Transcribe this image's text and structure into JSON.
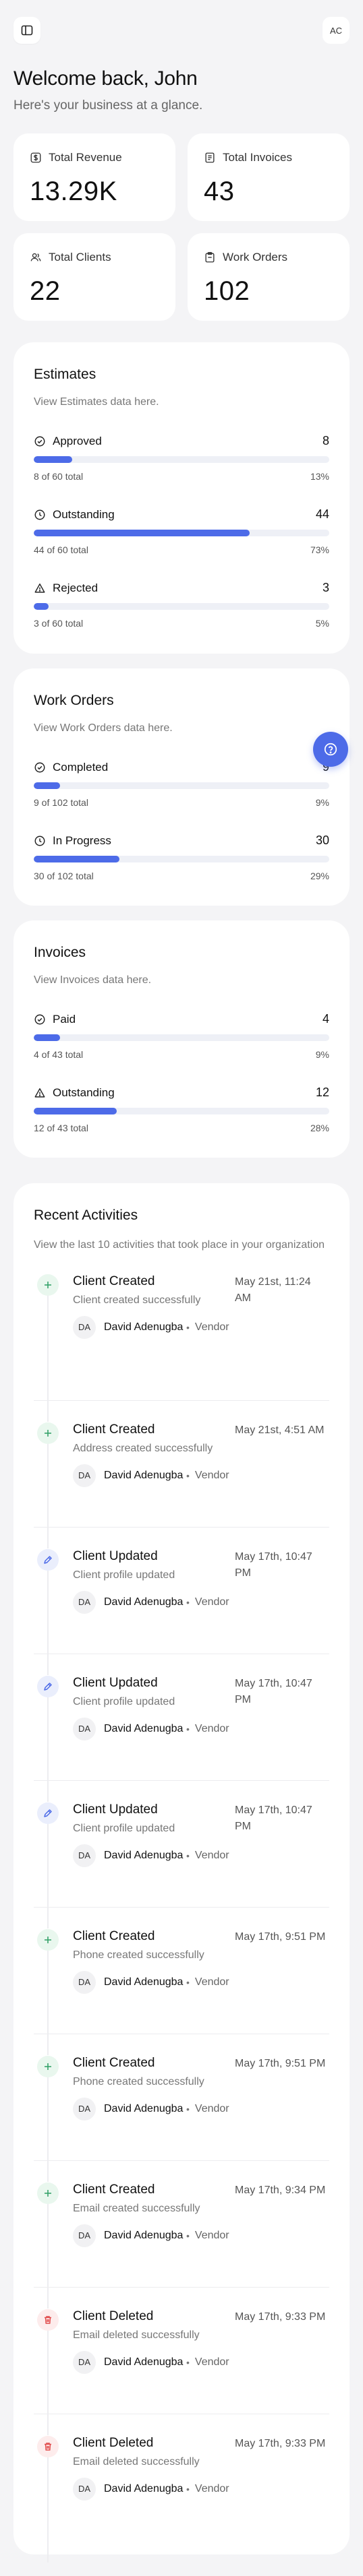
{
  "header": {
    "avatar_initials": "AC"
  },
  "welcome": {
    "title": "Welcome back, John",
    "subtitle": "Here's your business at a glance."
  },
  "stats": [
    {
      "label": "Total Revenue",
      "value": "13.29K",
      "icon": "dollar-icon"
    },
    {
      "label": "Total Invoices",
      "value": "43",
      "icon": "receipt-icon"
    },
    {
      "label": "Total Clients",
      "value": "22",
      "icon": "users-icon"
    },
    {
      "label": "Work Orders",
      "value": "102",
      "icon": "clipboard-icon"
    }
  ],
  "estimates": {
    "title": "Estimates",
    "subtitle": "View Estimates data here.",
    "metrics": [
      {
        "label": "Approved",
        "value": "8",
        "foot": "8 of 60 total",
        "pct": "13%",
        "fill": 0.13,
        "icon": "check-circle-icon"
      },
      {
        "label": "Outstanding",
        "value": "44",
        "foot": "44 of 60 total",
        "pct": "73%",
        "fill": 0.73,
        "icon": "clock-icon"
      },
      {
        "label": "Rejected",
        "value": "3",
        "foot": "3 of 60 total",
        "pct": "5%",
        "fill": 0.05,
        "icon": "warning-icon"
      }
    ]
  },
  "work_orders": {
    "title": "Work Orders",
    "subtitle": "View Work Orders data here.",
    "metrics": [
      {
        "label": "Completed",
        "value": "9",
        "foot": "9 of 102 total",
        "pct": "9%",
        "fill": 0.09,
        "icon": "check-circle-icon"
      },
      {
        "label": "In Progress",
        "value": "30",
        "foot": "30 of 102 total",
        "pct": "29%",
        "fill": 0.29,
        "icon": "clock-icon"
      }
    ]
  },
  "invoices": {
    "title": "Invoices",
    "subtitle": "View Invoices data here.",
    "metrics": [
      {
        "label": "Paid",
        "value": "4",
        "foot": "4 of 43 total",
        "pct": "9%",
        "fill": 0.09,
        "icon": "check-circle-icon"
      },
      {
        "label": "Outstanding",
        "value": "12",
        "foot": "12 of 43 total",
        "pct": "28%",
        "fill": 0.28,
        "icon": "warning-icon"
      }
    ]
  },
  "activities": {
    "title": "Recent Activities",
    "subtitle": "View the last 10 activities that took place in your organization",
    "items": [
      {
        "kind": "create",
        "title": "Client Created",
        "desc": "Client created successfully",
        "time": "May 21st, 11:24 AM",
        "initials": "DA",
        "user": "David Adenugba",
        "role": "Vendor"
      },
      {
        "kind": "create",
        "title": "Client Created",
        "desc": "Address created successfully",
        "time": "May 21st, 4:51 AM",
        "initials": "DA",
        "user": "David Adenugba",
        "role": "Vendor"
      },
      {
        "kind": "update",
        "title": "Client Updated",
        "desc": "Client profile updated",
        "time": "May 17th, 10:47 PM",
        "initials": "DA",
        "user": "David Adenugba",
        "role": "Vendor"
      },
      {
        "kind": "update",
        "title": "Client Updated",
        "desc": "Client profile updated",
        "time": "May 17th, 10:47 PM",
        "initials": "DA",
        "user": "David Adenugba",
        "role": "Vendor"
      },
      {
        "kind": "update",
        "title": "Client Updated",
        "desc": "Client profile updated",
        "time": "May 17th, 10:47 PM",
        "initials": "DA",
        "user": "David Adenugba",
        "role": "Vendor"
      },
      {
        "kind": "create",
        "title": "Client Created",
        "desc": "Phone created successfully",
        "time": "May 17th, 9:51 PM",
        "initials": "DA",
        "user": "David Adenugba",
        "role": "Vendor"
      },
      {
        "kind": "create",
        "title": "Client Created",
        "desc": "Phone created successfully",
        "time": "May 17th, 9:51 PM",
        "initials": "DA",
        "user": "David Adenugba",
        "role": "Vendor"
      },
      {
        "kind": "create",
        "title": "Client Created",
        "desc": "Email created successfully",
        "time": "May 17th, 9:34 PM",
        "initials": "DA",
        "user": "David Adenugba",
        "role": "Vendor"
      },
      {
        "kind": "delete",
        "title": "Client Deleted",
        "desc": "Email deleted successfully",
        "time": "May 17th, 9:33 PM",
        "initials": "DA",
        "user": "David Adenugba",
        "role": "Vendor"
      },
      {
        "kind": "delete",
        "title": "Client Deleted",
        "desc": "Email deleted successfully",
        "time": "May 17th, 9:33 PM",
        "initials": "DA",
        "user": "David Adenugba",
        "role": "Vendor"
      }
    ]
  },
  "colors": {
    "accent": "#4d6be8",
    "bar_track": "#eef0f6",
    "create": "#36a36b",
    "update": "#4d6be8",
    "delete": "#e04a4a"
  }
}
